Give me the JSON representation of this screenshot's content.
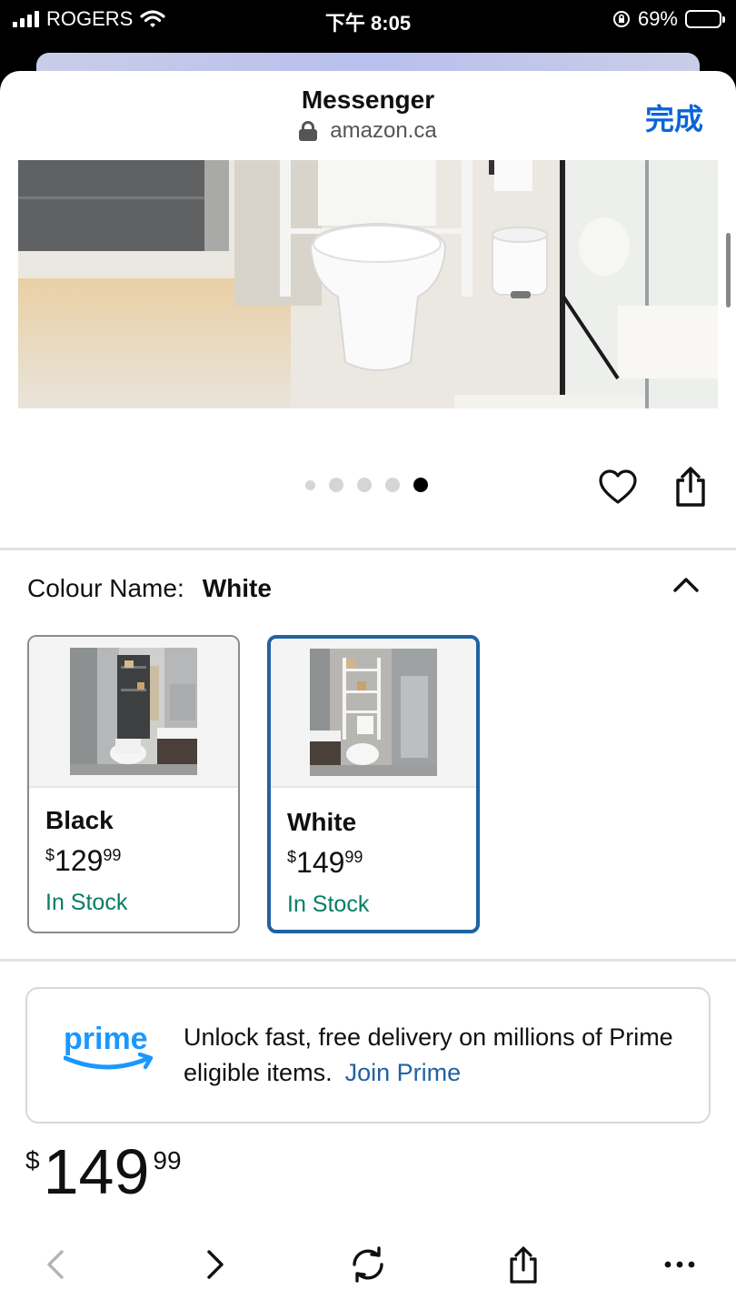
{
  "status_bar": {
    "carrier": "ROGERS",
    "time": "下午 8:05",
    "battery": "69%",
    "battery_level": 0.69
  },
  "header": {
    "title": "Messenger",
    "url": "amazon.ca",
    "done_label": "完成"
  },
  "gallery": {
    "image_count": 5,
    "active_index": 4
  },
  "colour": {
    "label": "Colour Name:",
    "value": "White"
  },
  "swatches": [
    {
      "name": "Black",
      "currency": "$",
      "whole": "129",
      "fraction": "99",
      "stock": "In Stock",
      "selected": false
    },
    {
      "name": "White",
      "currency": "$",
      "whole": "149",
      "fraction": "99",
      "stock": "In Stock",
      "selected": true
    }
  ],
  "prime": {
    "logo_text": "prime",
    "message": "Unlock fast, free delivery on millions of Prime eligible items.",
    "link": "Join Prime"
  },
  "price": {
    "currency": "$",
    "whole": "149",
    "fraction": "99"
  },
  "colors": {
    "accent_blue": "#2162a1",
    "ios_blue": "#0a64d8",
    "stock_green": "#067d62",
    "prime_blue": "#1a98ff"
  },
  "bottom_bar": {
    "icons": [
      "back-icon",
      "forward-icon",
      "refresh-icon",
      "share-icon",
      "more-icon"
    ]
  }
}
